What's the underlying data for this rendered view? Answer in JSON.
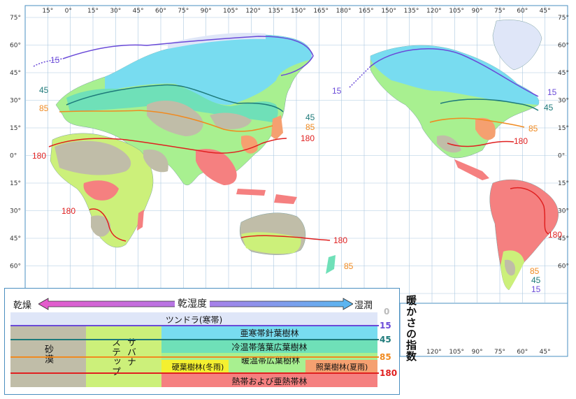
{
  "map": {
    "top_longitudes": [
      "15°",
      "0°",
      "15°",
      "30°",
      "45°",
      "60°",
      "75°",
      "90°",
      "105°",
      "120°",
      "135°",
      "150°",
      "165°",
      "180°",
      "165°",
      "150°",
      "135°",
      "120°",
      "105°",
      "90°",
      "75°",
      "60°",
      "45°"
    ],
    "bottom_longitudes": [
      "120°",
      "105°",
      "90°",
      "75°",
      "60°",
      "45°"
    ],
    "left_latitudes": [
      "75°",
      "60°",
      "45°",
      "30°",
      "15°",
      "0°",
      "15°",
      "30°",
      "45°",
      "60°"
    ],
    "right_latitudes": [
      "75°",
      "60°",
      "45°",
      "30°",
      "15°",
      "0°",
      "15°",
      "30°",
      "45°",
      "60°"
    ],
    "isoline_labels": {
      "l15_w": "15",
      "l45_w": "45",
      "l85_w": "85",
      "l180_w": "180",
      "l180_af": "180",
      "l15_ne": "15",
      "l45_ne": "45",
      "l85_ne": "85",
      "l180_ne": "180",
      "l180_au": "180",
      "l85_nz": "85",
      "l15_am": "15",
      "l45_am": "45",
      "l85_am": "85",
      "l180_am": "180",
      "l180_sa": "180",
      "l85_sa": "85",
      "l45_sa": "45",
      "l15_sa": "15"
    }
  },
  "legend": {
    "dry": "乾燥",
    "humidity": "乾湿度",
    "wet": "湿潤",
    "tundra": "ツンドラ(寒帯)",
    "subarctic": "亜寒帯針葉樹林",
    "cool_temperate": "冷温帯落葉広葉樹林",
    "warm_temperate": "暖温帯広葉樹林",
    "sclerophyll": "硬葉樹林(冬雨)",
    "laurel": "照葉樹林(夏雨)",
    "tropical": "熱帯および亜熱帯林",
    "desert": "砂漠",
    "savanna": "サバナ",
    "steppe": "ステップ",
    "warmth_index": "暖かさの指数",
    "values": [
      "0",
      "15",
      "45",
      "85",
      "180"
    ]
  },
  "colors": {
    "ocean": "#ffffff",
    "grid": "#aac8e0",
    "tundra": "#dfe6f8",
    "subarctic": "#78dcf0",
    "cool_temperate": "#6fe0b8",
    "warm_temperate": "#a8f090",
    "sclerophyll": "#f4f030",
    "laurel": "#f5a070",
    "tropical": "#f58080",
    "desert": "#c0bda8",
    "steppe": "#ccf07a",
    "line15": "#6a4ad8",
    "line45": "#1e7a7a",
    "line85": "#f08a20",
    "line180": "#e02020"
  }
}
